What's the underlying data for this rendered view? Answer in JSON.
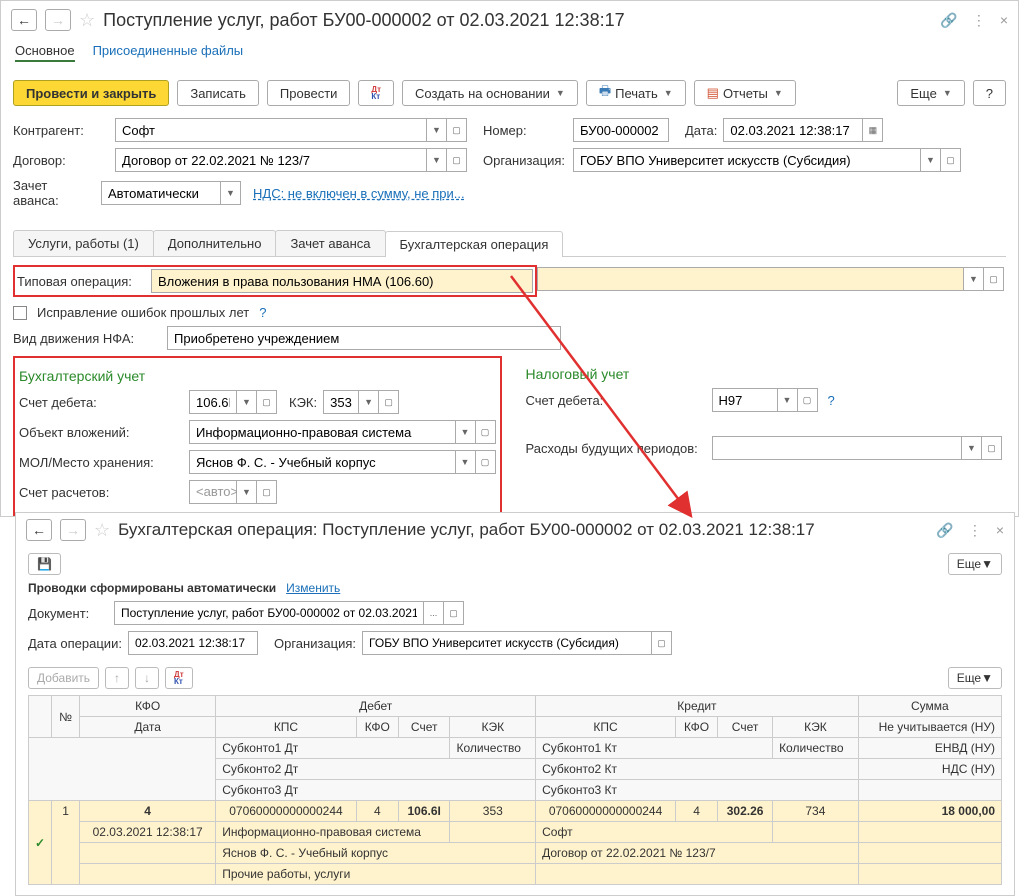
{
  "win1": {
    "title": "Поступление услуг, работ БУ00-000002 от 02.03.2021 12:38:17",
    "nav": {
      "main": "Основное",
      "attached": "Присоединенные файлы"
    },
    "toolbar": {
      "post_close": "Провести и закрыть",
      "save": "Записать",
      "post": "Провести",
      "create_based": "Создать на основании",
      "print": "Печать",
      "reports": "Отчеты",
      "more": "Еще",
      "help": "?"
    },
    "fields": {
      "counterparty_label": "Контрагент:",
      "counterparty": "Софт",
      "contract_label": "Договор:",
      "contract": "Договор от 22.02.2021 № 123/7",
      "number_label": "Номер:",
      "number": "БУ00-000002",
      "date_label": "Дата:",
      "date": "02.03.2021 12:38:17",
      "org_label": "Организация:",
      "org": "ГОБУ ВПО Университет искусств (Субсидия)",
      "advance_label": "Зачет аванса:",
      "advance": "Автоматически",
      "vat_link": "НДС: не включен в сумму, не при...",
      "typical_op_label": "Типовая операция:",
      "typical_op": "Вложения в права пользования НМА (106.60)",
      "fix_errors": "Исправление ошибок прошлых лет",
      "nfa_label": "Вид движения НФА:",
      "nfa": "Приобретено учреждением"
    },
    "tabs": {
      "t1": "Услуги, работы (1)",
      "t2": "Дополнительно",
      "t3": "Зачет аванса",
      "t4": "Бухгалтерская операция"
    },
    "acc": {
      "bu_title": "Бухгалтерский учет",
      "nu_title": "Налоговый учет",
      "debit_label": "Счет дебета:",
      "debit": "106.6I",
      "kek_label": "КЭК:",
      "kek": "353",
      "object_label": "Объект вложений:",
      "object": "Информационно-правовая система",
      "mol_label": "МОЛ/Место хранения:",
      "mol": "Яснов Ф. С. - Учебный корпус",
      "settle_label": "Счет расчетов:",
      "settle_ph": "<авто>",
      "nu_debit": "Н97",
      "future_label": "Расходы будущих периодов:"
    }
  },
  "win2": {
    "title": "Бухгалтерская операция: Поступление услуг, работ БУ00-000002 от 02.03.2021 12:38:17",
    "more": "Еще",
    "auto_text": "Проводки сформированы автоматически",
    "edit_link": "Изменить",
    "doc_label": "Документ:",
    "doc": "Поступление услуг, работ БУ00-000002 от 02.03.2021 1",
    "opdate_label": "Дата операции:",
    "opdate": "02.03.2021 12:38:17",
    "org_label": "Организация:",
    "org": "ГОБУ ВПО Университет искусств (Субсидия)",
    "add": "Добавить",
    "headers": {
      "num": "№",
      "kfo": "КФО",
      "date": "Дата",
      "debit": "Дебет",
      "credit": "Кредит",
      "sum": "Сумма",
      "kps": "КПС",
      "kfo2": "КФО",
      "account": "Счет",
      "kek": "КЭК",
      "qty": "Количество",
      "sub1d": "Субконто1 Дт",
      "sub2d": "Субконто2 Дт",
      "sub3d": "Субконто3 Дт",
      "sub1k": "Субконто1 Кт",
      "sub2k": "Субконто2 Кт",
      "sub3k": "Субконто3 Кт",
      "nu": "Не учитывается (НУ)",
      "envd": "ЕНВД (НУ)",
      "nds": "НДС (НУ)"
    },
    "row": {
      "num": "1",
      "kfo": "4",
      "date": "02.03.2021 12:38:17",
      "kps_d": "07060000000000244",
      "kfo_d": "4",
      "acc_d": "106.6I",
      "kek_d": "353",
      "sub1d": "Информационно-правовая система",
      "sub2d": "Яснов Ф. С. - Учебный корпус",
      "sub3d": "Прочие работы, услуги",
      "kps_k": "07060000000000244",
      "kfo_k": "4",
      "acc_k": "302.26",
      "kek_k": "734",
      "sub1k": "Софт",
      "sub2k": "Договор от 22.02.2021 № 123/7",
      "sum": "18 000,00"
    }
  }
}
